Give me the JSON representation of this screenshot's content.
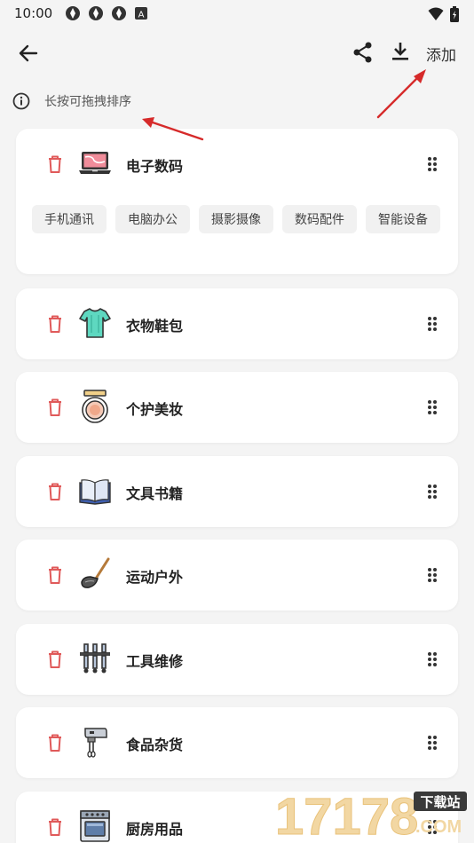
{
  "status": {
    "time": "10:00",
    "notice": "A"
  },
  "appbar": {
    "add_label": "添加"
  },
  "hint": {
    "text": "长按可拖拽排序"
  },
  "categories": [
    {
      "label": "电子数码",
      "icon": "laptop-icon",
      "subs": [
        "手机通讯",
        "电脑办公",
        "摄影摄像",
        "数码配件",
        "智能设备"
      ]
    },
    {
      "label": "衣物鞋包",
      "icon": "shirt-icon"
    },
    {
      "label": "个护美妆",
      "icon": "compact-mirror-icon"
    },
    {
      "label": "文具书籍",
      "icon": "open-book-icon"
    },
    {
      "label": "运动户外",
      "icon": "racket-icon"
    },
    {
      "label": "工具维修",
      "icon": "tool-rack-icon"
    },
    {
      "label": "食品杂货",
      "icon": "hand-mixer-icon"
    },
    {
      "label": "厨房用品",
      "icon": "oven-icon"
    }
  ],
  "watermark": {
    "number": "17178",
    "tag": "下载站",
    "suffix": ".COM"
  },
  "colors": {
    "trash": "#e05a5a",
    "annotation_arrow": "#d62a2a",
    "background": "#f4f4f4"
  }
}
